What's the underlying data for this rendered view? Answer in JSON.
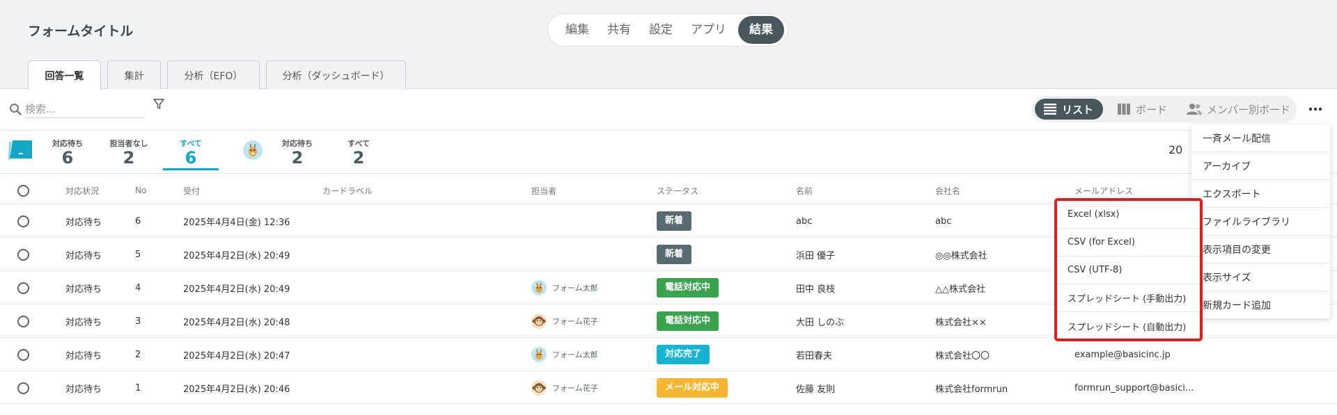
{
  "form": {
    "title": "フォームタイトル"
  },
  "modes": [
    {
      "label": "編集"
    },
    {
      "label": "共有"
    },
    {
      "label": "設定"
    },
    {
      "label": "アプリ"
    },
    {
      "label": "結果",
      "active": true
    }
  ],
  "tabs": [
    {
      "label": "回答一覧",
      "active": true
    },
    {
      "label": "集計"
    },
    {
      "label": "分析（EFO）"
    },
    {
      "label": "分析（ダッシュボード）"
    }
  ],
  "search": {
    "placeholder": "検索..."
  },
  "views": [
    {
      "label": "リスト",
      "icon": "list-icon",
      "active": true
    },
    {
      "label": "ボード",
      "icon": "board-icon"
    },
    {
      "label": "メンバー別ボード",
      "icon": "members-icon"
    }
  ],
  "counters": {
    "group1": [
      {
        "label": "対応待ち",
        "value": "6"
      },
      {
        "label": "担当者なし",
        "value": "2"
      },
      {
        "label": "すべて",
        "value": "6",
        "active": true
      }
    ],
    "group2": [
      {
        "label": "対応待ち",
        "value": "2"
      },
      {
        "label": "すべて",
        "value": "2"
      }
    ]
  },
  "per_page": "20",
  "columns": {
    "status": "対応状況",
    "no": "No",
    "received": "受付",
    "card_label": "カードラベル",
    "assignee": "担当者",
    "state": "ステータス",
    "name": "名前",
    "company": "会社名",
    "email": "メールアドレス"
  },
  "rows": [
    {
      "status": "対応待ち",
      "no": "6",
      "received": "2025年4月4日(金) 12:36",
      "assignee": "",
      "assignee_avatar": "",
      "state": "新着",
      "state_color": "#5a6a72",
      "name": "abc",
      "company": "abc",
      "email": ""
    },
    {
      "status": "対応待ち",
      "no": "5",
      "received": "2025年4月2日(水) 20:49",
      "assignee": "",
      "assignee_avatar": "",
      "state": "新着",
      "state_color": "#5a6a72",
      "name": "浜田 優子",
      "company": "◎◎株式会社",
      "email": ""
    },
    {
      "status": "対応待ち",
      "no": "4",
      "received": "2025年4月2日(水) 20:49",
      "assignee": "フォーム太郎",
      "assignee_avatar": "giraffe",
      "state": "電話対応中",
      "state_color": "#3aa34d",
      "name": "田中 良枝",
      "company": "△△株式会社",
      "email": ""
    },
    {
      "status": "対応待ち",
      "no": "3",
      "received": "2025年4月2日(水) 20:48",
      "assignee": "フォーム花子",
      "assignee_avatar": "monkey",
      "state": "電話対応中",
      "state_color": "#3aa34d",
      "name": "大田 しのぶ",
      "company": "株式会社××",
      "email": ""
    },
    {
      "status": "対応待ち",
      "no": "2",
      "received": "2025年4月2日(水) 20:47",
      "assignee": "フォーム太郎",
      "assignee_avatar": "giraffe",
      "state": "対応完了",
      "state_color": "#14b4d2",
      "name": "若田春夫",
      "company": "株式会社〇〇",
      "email": "example@basicinc.jp"
    },
    {
      "status": "対応待ち",
      "no": "1",
      "received": "2025年4月2日(水) 20:46",
      "assignee": "フォーム花子",
      "assignee_avatar": "monkey",
      "state": "メール対応中",
      "state_color": "#f5b731",
      "name": "佐藤 友則",
      "company": "株式会社formrun",
      "email": "formrun_support@basici..."
    }
  ],
  "more_menu": [
    {
      "label": "一斉メール配信"
    },
    {
      "label": "アーカイブ"
    },
    {
      "label": "エクスポート"
    },
    {
      "label": "ファイルライブラリ"
    },
    {
      "label": "表示項目の変更"
    },
    {
      "label": "表示サイズ"
    },
    {
      "label": "新規カード追加"
    }
  ],
  "export_menu": [
    {
      "label": "Excel (xlsx)"
    },
    {
      "label": "CSV (for Excel)"
    },
    {
      "label": "CSV (UTF-8)"
    },
    {
      "label": "スプレッドシート (手動出力)"
    },
    {
      "label": "スプレッドシート (自動出力)"
    }
  ],
  "colors": {
    "accent": "#11a8c7",
    "dark": "#48565d",
    "highlight_border": "#e41c1c"
  }
}
